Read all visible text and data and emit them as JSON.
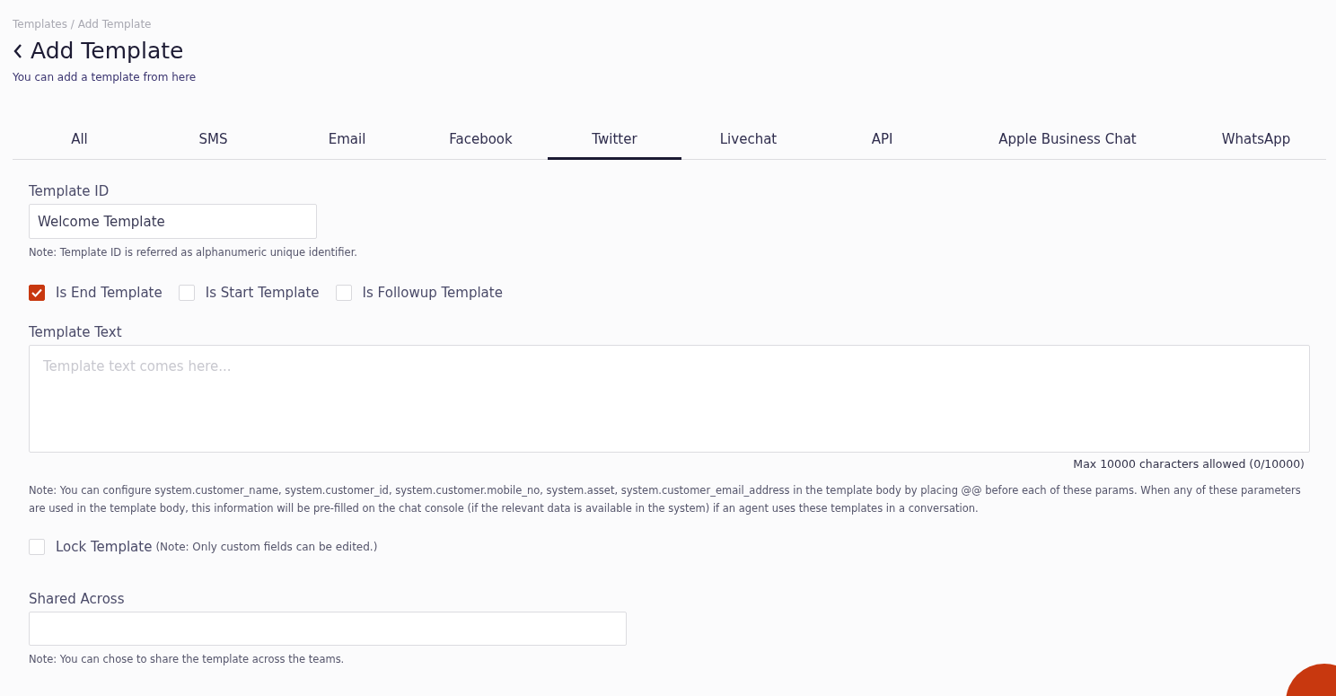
{
  "breadcrumb": "Templates / Add Template",
  "title": "Add Template",
  "subtitle": "You can add a template from here",
  "tabs": [
    {
      "label": "All",
      "selected": false
    },
    {
      "label": "SMS",
      "selected": false
    },
    {
      "label": "Email",
      "selected": false
    },
    {
      "label": "Facebook",
      "selected": false
    },
    {
      "label": "Twitter",
      "selected": true
    },
    {
      "label": "Livechat",
      "selected": false
    },
    {
      "label": "API",
      "selected": false
    },
    {
      "label": "Apple Business Chat",
      "selected": false
    },
    {
      "label": "WhatsApp",
      "selected": false
    }
  ],
  "template_id": {
    "label": "Template ID",
    "value": "Welcome Template",
    "note": "Note: Template ID is referred as alphanumeric unique identifier."
  },
  "flags": [
    {
      "label": "Is End Template",
      "checked": true
    },
    {
      "label": "Is Start Template",
      "checked": false
    },
    {
      "label": "Is Followup Template",
      "checked": false
    }
  ],
  "template_text": {
    "label": "Template Text",
    "placeholder": "Template text comes here...",
    "counter": "Max 10000 characters allowed (0/10000)",
    "note": "Note: You can configure system.customer_name, system.customer_id, system.customer.mobile_no, system.asset, system.customer_email_address in the template body by placing @@ before each of these params. When any of these parameters are used in the template body, this information will be pre-filled on the chat console (if the relevant data is available in the system) if an agent uses these templates in a conversation."
  },
  "lock": {
    "label": "Lock Template",
    "hint": "(Note: Only custom fields can be edited.)",
    "checked": false
  },
  "shared_across": {
    "label": "Shared Across",
    "note": "Note: You can chose to share the template across the teams."
  }
}
